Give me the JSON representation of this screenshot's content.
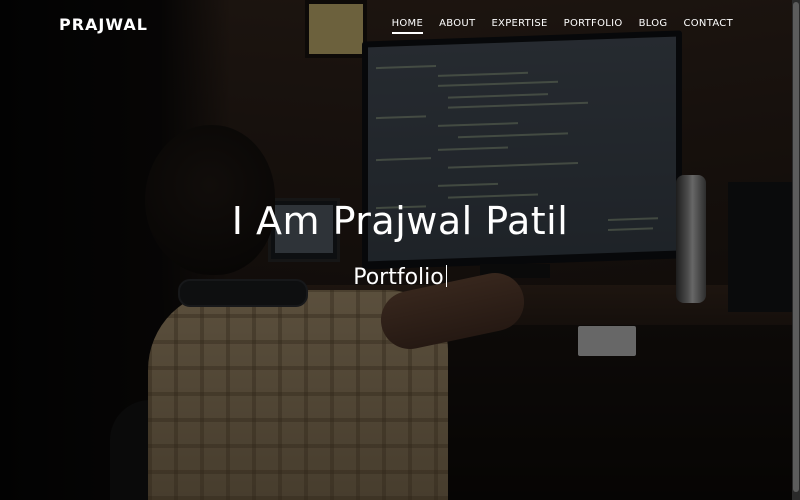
{
  "header": {
    "logo": "PRAJWAL",
    "nav": [
      {
        "label": "HOME",
        "active": true
      },
      {
        "label": "ABOUT",
        "active": false
      },
      {
        "label": "EXPERTISE",
        "active": false
      },
      {
        "label": "PORTFOLIO",
        "active": false
      },
      {
        "label": "BLOG",
        "active": false
      },
      {
        "label": "CONTACT",
        "active": false
      }
    ]
  },
  "hero": {
    "title": "I Am Prajwal Patil",
    "subtitle": "Portfolio",
    "background_icon": "photo-developer-at-monitor"
  },
  "colors": {
    "text": "#ffffff",
    "overlay": "#000000"
  }
}
